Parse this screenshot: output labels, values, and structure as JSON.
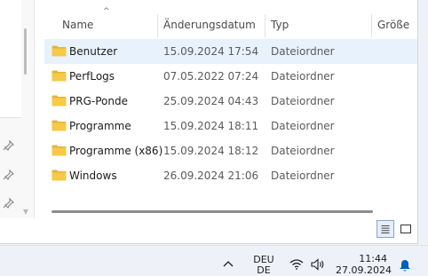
{
  "columns": {
    "name": "Name",
    "date": "Änderungsdatum",
    "type": "Typ",
    "size": "Größe"
  },
  "files": [
    {
      "name": "Benutzer",
      "date": "15.09.2024 17:54",
      "type": "Dateiordner"
    },
    {
      "name": "PerfLogs",
      "date": "07.05.2022 07:24",
      "type": "Dateiordner"
    },
    {
      "name": "PRG-Ponde",
      "date": "25.09.2024 04:43",
      "type": "Dateiordner"
    },
    {
      "name": "Programme",
      "date": "15.09.2024 18:11",
      "type": "Dateiordner"
    },
    {
      "name": "Programme (x86)",
      "date": "15.09.2024 18:12",
      "type": "Dateiordner"
    },
    {
      "name": "Windows",
      "date": "26.09.2024 21:06",
      "type": "Dateiordner"
    }
  ],
  "taskbar": {
    "lang_line1": "DEU",
    "lang_line2": "DE",
    "time": "11:44",
    "date": "27.09.2024"
  },
  "icons": {
    "folder": "folder-icon",
    "pin": "pin-icon",
    "sort": "sort-ascending-icon",
    "chevron_up": "chevron-up-icon",
    "wifi": "wifi-icon",
    "volume": "volume-icon",
    "bell": "notification-bell-icon"
  },
  "colors": {
    "selection": "#e8f2fd",
    "folder": "#f7c948",
    "accent": "#005fb8"
  }
}
